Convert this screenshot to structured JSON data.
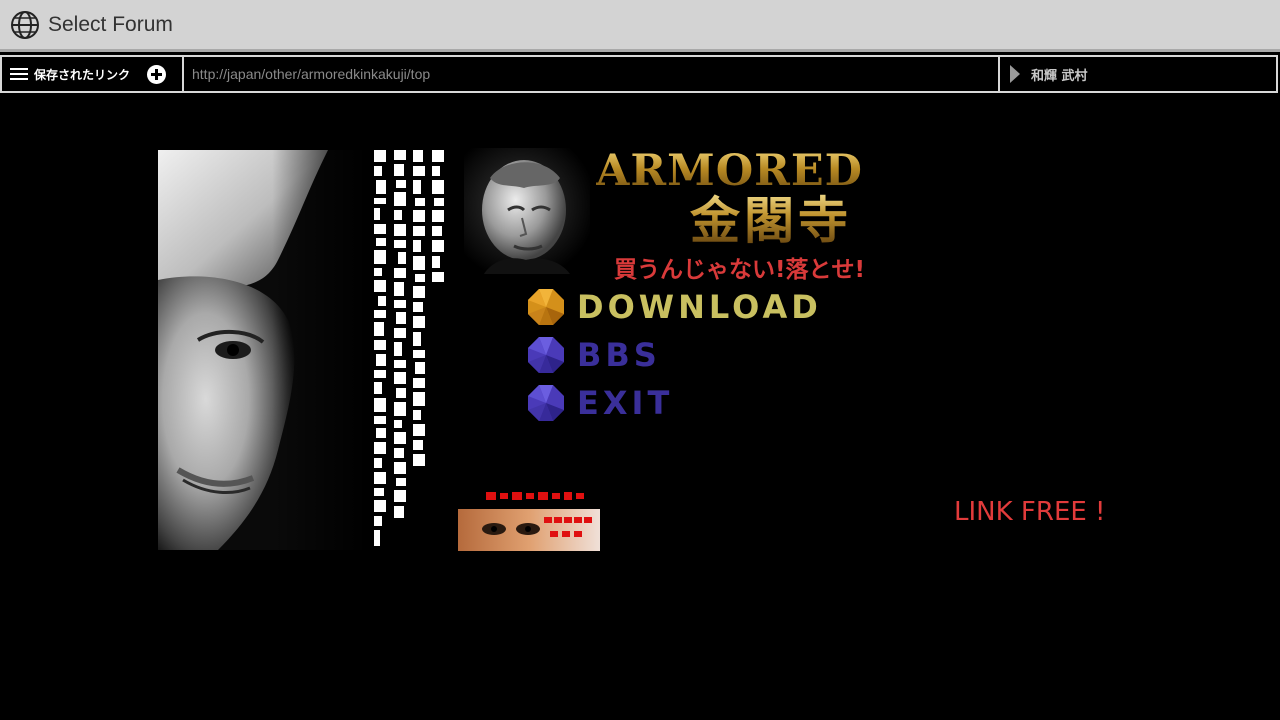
{
  "window": {
    "title": "Select Forum",
    "icon": "globe-icon"
  },
  "navbar": {
    "saved_links_label": "保存されたリンク",
    "url": "http://japan/other/armoredkinkakuji/top",
    "user": "和輝 武村"
  },
  "page": {
    "logo_en": "ARMORED",
    "logo_jp": "金閣寺",
    "tagline": "買うんじゃない!落とせ!",
    "menu": [
      {
        "label": "DOWNLOAD",
        "color": "#c9c060",
        "button_color": "#d4901a"
      },
      {
        "label": "BBS",
        "color": "#3a2f9a",
        "button_color": "#4a3ab8"
      },
      {
        "label": "EXIT",
        "color": "#3a2f9a",
        "button_color": "#4a3ab8"
      }
    ],
    "link_free": "LINK FREE !"
  },
  "colors": {
    "background": "#000000",
    "title_bar": "#d3d3d3",
    "tagline": "#d93a3a",
    "link_free": "#e23b3b"
  }
}
